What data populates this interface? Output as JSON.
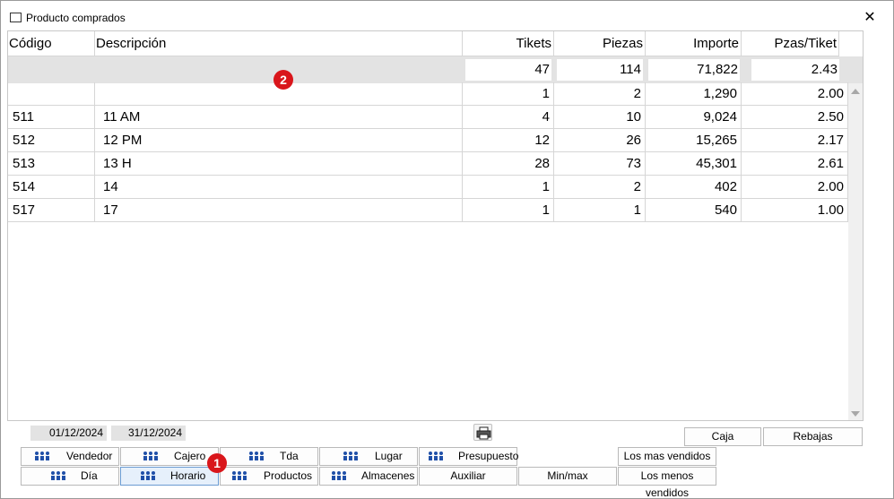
{
  "window": {
    "title": "Producto comprados",
    "close_glyph": "✕"
  },
  "table": {
    "columns": [
      "Código",
      "Descripción",
      "Tikets",
      "Piezas",
      "Importe",
      "Pzas/Tiket"
    ],
    "totals": {
      "tikets": "47",
      "piezas": "114",
      "importe": "71,822",
      "pzas_tiket": "2.43"
    },
    "rows": [
      {
        "codigo": "",
        "descripcion": "",
        "tikets": "1",
        "piezas": "2",
        "importe": "1,290",
        "pzas_tiket": "2.00"
      },
      {
        "codigo": "511",
        "descripcion": "11 AM",
        "tikets": "4",
        "piezas": "10",
        "importe": "9,024",
        "pzas_tiket": "2.50"
      },
      {
        "codigo": "512",
        "descripcion": "12 PM",
        "tikets": "12",
        "piezas": "26",
        "importe": "15,265",
        "pzas_tiket": "2.17"
      },
      {
        "codigo": "513",
        "descripcion": "13 H",
        "tikets": "28",
        "piezas": "73",
        "importe": "45,301",
        "pzas_tiket": "2.61"
      },
      {
        "codigo": "514",
        "descripcion": "14",
        "tikets": "1",
        "piezas": "2",
        "importe": "402",
        "pzas_tiket": "2.00"
      },
      {
        "codigo": "517",
        "descripcion": "17",
        "tikets": "1",
        "piezas": "1",
        "importe": "540",
        "pzas_tiket": "1.00"
      }
    ]
  },
  "markers": {
    "one": "1",
    "two": "2"
  },
  "filters": {
    "date_from": "01/12/2024",
    "date_to": "31/12/2024"
  },
  "buttons": {
    "caja": "Caja",
    "rebajas": "Rebajas",
    "vendedor": "Vendedor",
    "cajero": "Cajero",
    "tda": "Tda",
    "lugar": "Lugar",
    "presupuesto": "Presupuesto",
    "los_mas_vendidos": "Los mas vendidos",
    "dia": "Día",
    "horario": "Horario",
    "productos": "Productos",
    "almacenes": "Almacenes",
    "auxiliar": "Auxiliar",
    "min_max": "Min/max",
    "los_menos_vendidos": "Los menos vendidos"
  },
  "colors": {
    "accent": "#d9161b",
    "selected_button": "#e6f0fb",
    "icon_blue": "#1f4fa8"
  },
  "icons": {
    "group": "people-group-icon",
    "print": "printer-icon"
  }
}
